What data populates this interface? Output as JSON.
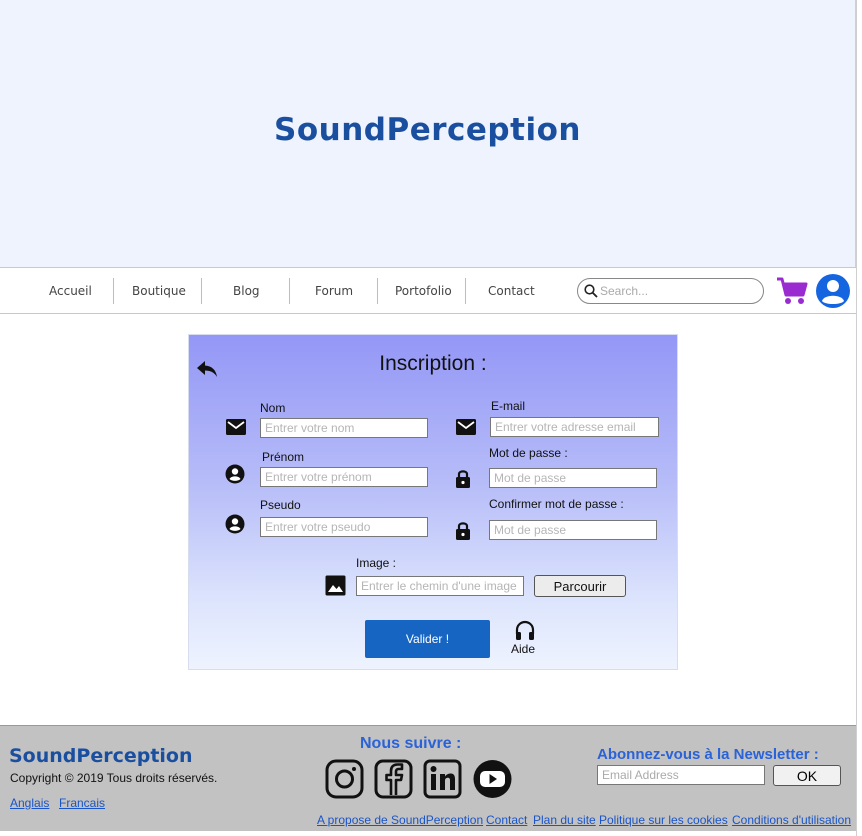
{
  "header": {
    "brand": "SoundPerception"
  },
  "nav": {
    "items": [
      "Accueil",
      "Boutique",
      "Blog",
      "Forum",
      "Portofolio",
      "Contact"
    ],
    "search_placeholder": "Search..."
  },
  "colors": {
    "brand": "#1a4fa0",
    "cart": "#9a2bd1",
    "user": "#1565e0",
    "submit": "#1765c2",
    "footer_bg": "#c2c2c2",
    "link": "#1a55c8"
  },
  "icons": {
    "back": "reply-arrow-icon",
    "mail": "envelope-icon",
    "person": "person-circle-icon",
    "lock": "padlock-icon",
    "image": "image-icon",
    "help": "headset-icon",
    "cart": "shopping-cart-icon",
    "user": "user-account-icon"
  },
  "form": {
    "title": "Inscription :",
    "nom": {
      "label": "Nom",
      "placeholder": "Entrer votre nom"
    },
    "prenom": {
      "label": "Prénom",
      "placeholder": "Entrer votre prénom"
    },
    "pseudo": {
      "label": "Pseudo",
      "placeholder": "Entrer votre pseudo"
    },
    "email": {
      "label": "E-mail",
      "placeholder": "Entrer votre adresse email"
    },
    "password": {
      "label": "Mot de passe :",
      "placeholder": "Mot de passe"
    },
    "confirm": {
      "label": "Confirmer mot de passe :",
      "placeholder": "Mot de passe"
    },
    "image": {
      "label": "Image :",
      "placeholder": "Entrer le chemin d'une image"
    },
    "browse": "Parcourir",
    "submit": "Valider !",
    "help": "Aide"
  },
  "footer": {
    "brand": "SoundPerception",
    "copyright": "Copyright © 2019 Tous droits réservés.",
    "languages": [
      "Anglais",
      "Francais"
    ],
    "follow": "Nous suivre :",
    "social": [
      "instagram-icon",
      "facebook-icon",
      "linkedin-icon",
      "youtube-icon"
    ],
    "newsletter": "Abonnez-vous à la Newsletter :",
    "email_placeholder": "Email Address",
    "ok": "OK",
    "links": [
      "A propose de SoundPerception",
      "Contact",
      "Plan du site",
      "Politique sur les cookies",
      "Conditions d'utilisation"
    ]
  }
}
